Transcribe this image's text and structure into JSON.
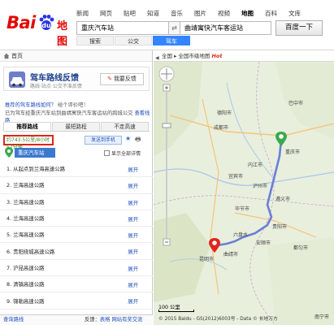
{
  "logo": {
    "part1": "Bai",
    "part2": "du",
    "suffix": "地图"
  },
  "top_nav": [
    "新闻",
    "网页",
    "贴吧",
    "知道",
    "音乐",
    "图片",
    "视频",
    "地图",
    "百科",
    "文库"
  ],
  "top_nav_active": "地图",
  "search": {
    "origin_value": "重庆汽车站",
    "destination_value": "曲靖寓快汽车客运站",
    "swap_symbol": "⇄",
    "button_label": "百度一下"
  },
  "modes": [
    "搜索",
    "公交",
    "驾车"
  ],
  "mode_active": "驾车",
  "left_panel": {
    "home_label": "首页",
    "banner_title": "驾车路线反馈",
    "banner_subtitle": "路线·站点·公交不准反馈",
    "feedback_button": "我要反馈",
    "link_1": "推荐的驾车路线如何？",
    "link_1_suffix": "给个评价吧！",
    "link_2": "已为驾车经重庆汽车站到曲靖寓快汽车客运站的跨城公交",
    "link_2_action": "查看线路",
    "tabs": [
      "推荐路线",
      "最短路程",
      "不走高速"
    ],
    "tab_active": "推荐路线",
    "summary": "约743.5公里/8小时57分钟",
    "send_to_phone": "发送到手机",
    "origin_label": "重庆汽车站",
    "show_all_label": "显示全部详情",
    "expand_label": "展开",
    "steps": [
      "1. 从起点到兰海高速公路",
      "2. 兰海高速公路",
      "3. 兰海高速公路",
      "4. 兰海高速公路",
      "5. 兰海高速公路",
      "6. 贵阳绕城高速公路",
      "7. 沪昆高速公路",
      "8. 清镇高速公路",
      "9. 锦勒高速公路",
      "10. 锦勒高速公路"
    ],
    "footer_left": "查询路线",
    "footer_right_label": "反馈：",
    "footer_right_1": "表格",
    "footer_right_2": "网站有奖交流"
  },
  "map": {
    "collapse_symbol": "◀",
    "breadcrumb": "全国 ▸ 全国市级地图",
    "hot_label": "Hot",
    "cities": [
      "成都市",
      "德阳市",
      "重庆市",
      "遵义市",
      "贵阳市",
      "毕节市",
      "六盘水",
      "昆明市",
      "曲靖市",
      "安顺市",
      "都匀市",
      "宜宾市",
      "泸州市",
      "内江市",
      "巴中市",
      "南宁市"
    ],
    "scale_label": "100 公里",
    "copyright": "© 2015 Baidu - GS(2012)6003号 - Data © 长地万方",
    "corner_label": "南宁市",
    "colors": {
      "route": "#6b7fd7",
      "start_pin": "#3aa94e",
      "end_pin": "#e1251b",
      "water": "#a8c8ec"
    }
  }
}
